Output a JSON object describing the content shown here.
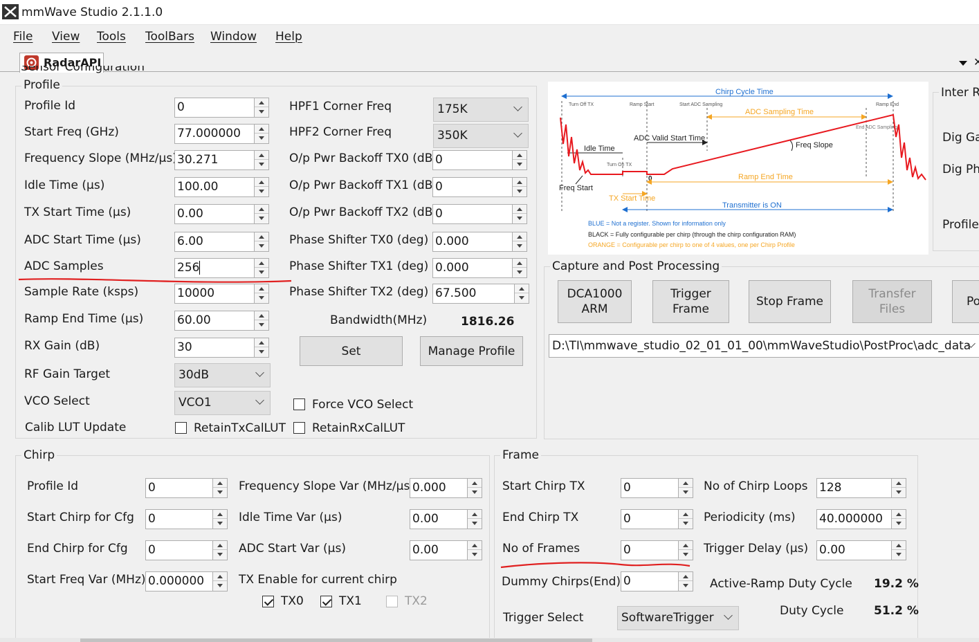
{
  "window": {
    "title": "mmWave Studio 2.1.1.0"
  },
  "menu": [
    "File",
    "View",
    "Tools",
    "ToolBars",
    "Window",
    "Help"
  ],
  "tab": {
    "label": "RadarAPI",
    "hidden_heading": "Sensor Configuration"
  },
  "profile": {
    "title": "Profile",
    "left": [
      {
        "label": "Profile Id",
        "value": "0"
      },
      {
        "label": "Start Freq (GHz)",
        "value": "77.000000"
      },
      {
        "label": "Frequency Slope (MHz/µs)",
        "value": "30.271"
      },
      {
        "label": "Idle Time (µs)",
        "value": "100.00"
      },
      {
        "label": "TX Start Time (µs)",
        "value": "0.00"
      },
      {
        "label": "ADC Start Time (µs)",
        "value": "6.00"
      },
      {
        "label": "ADC Samples",
        "value": "256"
      },
      {
        "label": "Sample Rate (ksps)",
        "value": "10000"
      },
      {
        "label": "Ramp End Time (µs)",
        "value": "60.00"
      },
      {
        "label": "RX Gain (dB)",
        "value": "30"
      }
    ],
    "rf_gain": {
      "label": "RF Gain Target",
      "value": "30dB"
    },
    "vco": {
      "label": "VCO Select",
      "value": "VCO1"
    },
    "calib": {
      "label": "Calib LUT Update",
      "retain_tx": "RetainTxCalLUT",
      "retain_rx": "RetainRxCalLUT"
    },
    "hpf1": {
      "label": "HPF1 Corner Freq",
      "value": "175K"
    },
    "hpf2": {
      "label": "HPF2 Corner Freq",
      "value": "350K"
    },
    "right": [
      {
        "label": "O/p Pwr Backoff TX0 (dB)",
        "value": "0"
      },
      {
        "label": "O/p Pwr Backoff TX1 (dB)",
        "value": "0"
      },
      {
        "label": "O/p Pwr Backoff TX2 (dB)",
        "value": "0"
      },
      {
        "label": "Phase Shifter TX0 (deg)",
        "value": "0.000"
      },
      {
        "label": "Phase Shifter TX1 (deg)",
        "value": "0.000"
      },
      {
        "label": "Phase Shifter TX2 (deg)",
        "value": "67.500"
      }
    ],
    "bandwidth": {
      "label": "Bandwidth(MHz)",
      "value": "1816.26"
    },
    "set_label": "Set",
    "manage_label": "Manage Profile",
    "force_vco": "Force VCO Select"
  },
  "diagram": {
    "chirp_cycle": "Chirp Cycle Time",
    "turn_off_tx": "Turn Off TX",
    "ramp_start": "Ramp Start",
    "start_adc": "Start ADC Sampling",
    "ramp_end": "Ramp End",
    "adc_sampling_time": "ADC Sampling Time",
    "end_adc": "End ADC Sampling",
    "adc_valid": "ADC Valid Start Time",
    "idle_time": "Idle Time",
    "freq_slope": "Freq Slope",
    "turn_on_tx": "Turn On TX",
    "zero": "0",
    "ramp_end_time": "Ramp End Time",
    "freq_start": "Freq Start",
    "tx_start_time": "TX Start Time",
    "transmitter_on": "Transmitter is ON",
    "legend_blue": "BLUE = Not a register. Shown for information only",
    "legend_black": "BLACK = Fully configurable per chirp (through the chirp configuration RAM)",
    "legend_orange": "ORANGE = Configurable per chirp to one of 4 values, one per Chirp Profile"
  },
  "inter": {
    "title": "Inter R",
    "dig_ga": "Dig Ga",
    "dig_ph": "Dig Ph",
    "profile": "Profile"
  },
  "capture": {
    "title": "Capture and Post Processing",
    "dca": "DCA1000 ARM",
    "trigger": "Trigger Frame",
    "stop": "Stop Frame",
    "transfer": "Transfer Files",
    "p": "Po",
    "path": "D:\\TI\\mmwave_studio_02_01_01_00\\mmWaveStudio\\PostProc\\adc_data"
  },
  "chirp": {
    "title": "Chirp",
    "left": [
      {
        "label": "Profile Id",
        "value": "0"
      },
      {
        "label": "Start Chirp for Cfg",
        "value": "0"
      },
      {
        "label": "End Chirp for Cfg",
        "value": "0"
      },
      {
        "label": "Start Freq Var (MHz)",
        "value": "0.000000"
      }
    ],
    "right": [
      {
        "label": "Frequency Slope Var (MHz/µs)",
        "value": "0.000"
      },
      {
        "label": "Idle Time Var (µs)",
        "value": "0.00"
      },
      {
        "label": "ADC Start Var (µs)",
        "value": "0.00"
      }
    ],
    "tx_enable": "TX Enable for current chirp",
    "tx0": "TX0",
    "tx1": "TX1",
    "tx2": "TX2"
  },
  "frame": {
    "title": "Frame",
    "left": [
      {
        "label": "Start Chirp TX",
        "value": "0"
      },
      {
        "label": "End Chirp TX",
        "value": "0"
      },
      {
        "label": "No of Frames",
        "value": "0"
      },
      {
        "label": "Dummy Chirps(End)",
        "value": "0"
      }
    ],
    "right": [
      {
        "label": "No of Chirp Loops",
        "value": "128"
      },
      {
        "label": "Periodicity (ms)",
        "value": "40.000000"
      },
      {
        "label": "Trigger Delay (µs)",
        "value": "0.00"
      }
    ],
    "active_ramp": {
      "label": "Active-Ramp Duty Cycle",
      "value": "19.2 %"
    },
    "duty": {
      "label": "Duty Cycle",
      "value": "51.2 %"
    },
    "trigger_select": {
      "label": "Trigger Select",
      "value": "SoftwareTrigger"
    }
  },
  "colors": {
    "annotation_red": "#e02020",
    "diagram_blue": "#1e6fd0",
    "diagram_orange": "#f5a623",
    "ramp_red": "#e8191f"
  }
}
